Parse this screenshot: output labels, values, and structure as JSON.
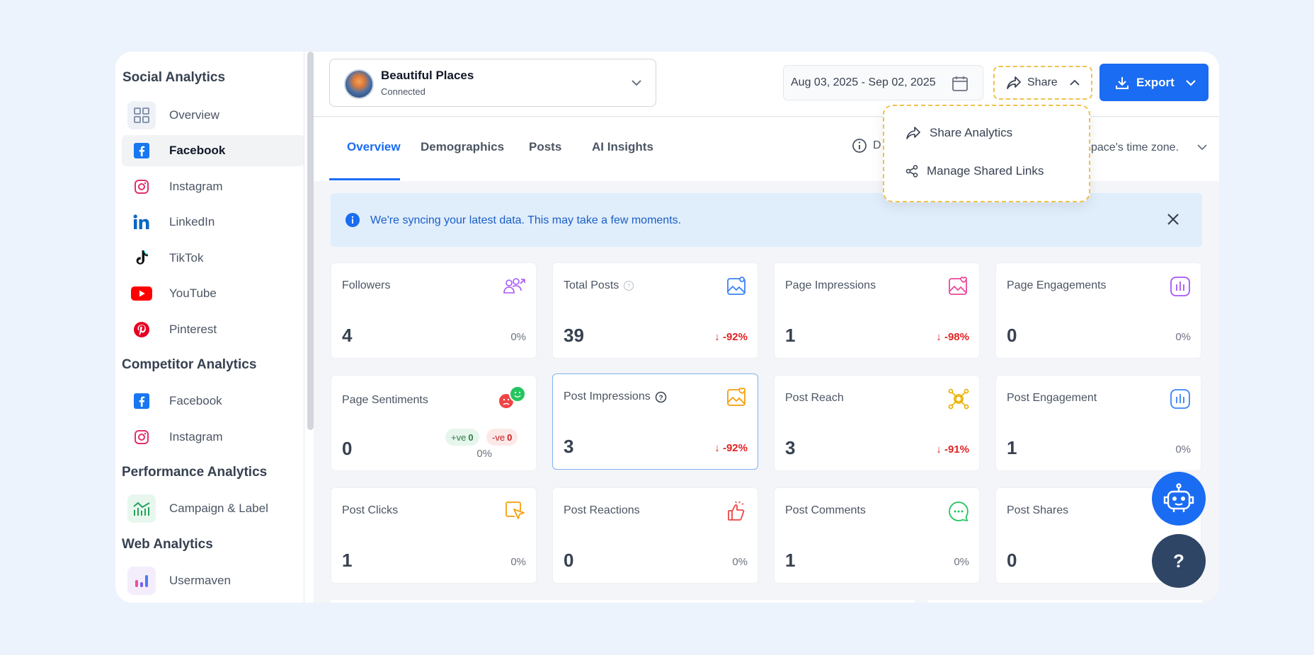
{
  "sidebar": {
    "social_title": "Social Analytics",
    "social_items": [
      {
        "label": "Overview",
        "icon": "grid-icon"
      },
      {
        "label": "Facebook",
        "icon": "facebook-icon"
      },
      {
        "label": "Instagram",
        "icon": "instagram-icon"
      },
      {
        "label": "LinkedIn",
        "icon": "linkedin-icon"
      },
      {
        "label": "TikTok",
        "icon": "tiktok-icon"
      },
      {
        "label": "YouTube",
        "icon": "youtube-icon"
      },
      {
        "label": "Pinterest",
        "icon": "pinterest-icon"
      }
    ],
    "competitor_title": "Competitor Analytics",
    "competitor_items": [
      {
        "label": "Facebook",
        "icon": "facebook-icon"
      },
      {
        "label": "Instagram",
        "icon": "instagram-icon"
      }
    ],
    "performance_title": "Performance Analytics",
    "performance_items": [
      {
        "label": "Campaign & Label",
        "icon": "campaign-chart-icon"
      }
    ],
    "web_title": "Web Analytics",
    "web_items": [
      {
        "label": "Usermaven",
        "icon": "usermaven-icon"
      }
    ]
  },
  "header": {
    "account_name": "Beautiful Places",
    "account_status": "Connected",
    "date_range": "Aug 03, 2025 - Sep 02, 2025",
    "share_label": "Share",
    "export_label": "Export"
  },
  "tabs": [
    "Overview",
    "Demographics",
    "Posts",
    "AI Insights"
  ],
  "timezone": {
    "prefix": "D",
    "text": "space's time zone."
  },
  "share_menu": {
    "items": [
      "Share Analytics",
      "Manage Shared Links"
    ]
  },
  "alert": {
    "message": "We're syncing your latest data. This may take a few moments."
  },
  "metrics": [
    {
      "title": "Followers",
      "value": "4",
      "change": "0%",
      "negative": false
    },
    {
      "title": "Total Posts",
      "value": "39",
      "change": "-92%",
      "negative": true
    },
    {
      "title": "Page Impressions",
      "value": "1",
      "change": "-98%",
      "negative": true
    },
    {
      "title": "Page Engagements",
      "value": "0",
      "change": "0%",
      "negative": false
    },
    {
      "title": "Page Sentiments",
      "value": "0",
      "change": "0%",
      "negative": false,
      "positive_label": "+ve",
      "positive_count": "0",
      "negative_label": "-ve",
      "negative_count": "0"
    },
    {
      "title": "Post Impressions",
      "value": "3",
      "change": "-92%",
      "negative": true
    },
    {
      "title": "Post Reach",
      "value": "3",
      "change": "-91%",
      "negative": true
    },
    {
      "title": "Post Engagement",
      "value": "1",
      "change": "0%",
      "negative": false
    },
    {
      "title": "Post Clicks",
      "value": "1",
      "change": "0%",
      "negative": false
    },
    {
      "title": "Post Reactions",
      "value": "0",
      "change": "0%",
      "negative": false
    },
    {
      "title": "Post Comments",
      "value": "1",
      "change": "0%",
      "negative": false
    },
    {
      "title": "Post Shares",
      "value": "0",
      "change": "",
      "negative": false
    }
  ],
  "help_label": "?",
  "colors": {
    "primary": "#1a6cf2",
    "highlight_dashed": "#f0c24b",
    "negative": "#e02424",
    "help_bg": "#2f4566"
  }
}
